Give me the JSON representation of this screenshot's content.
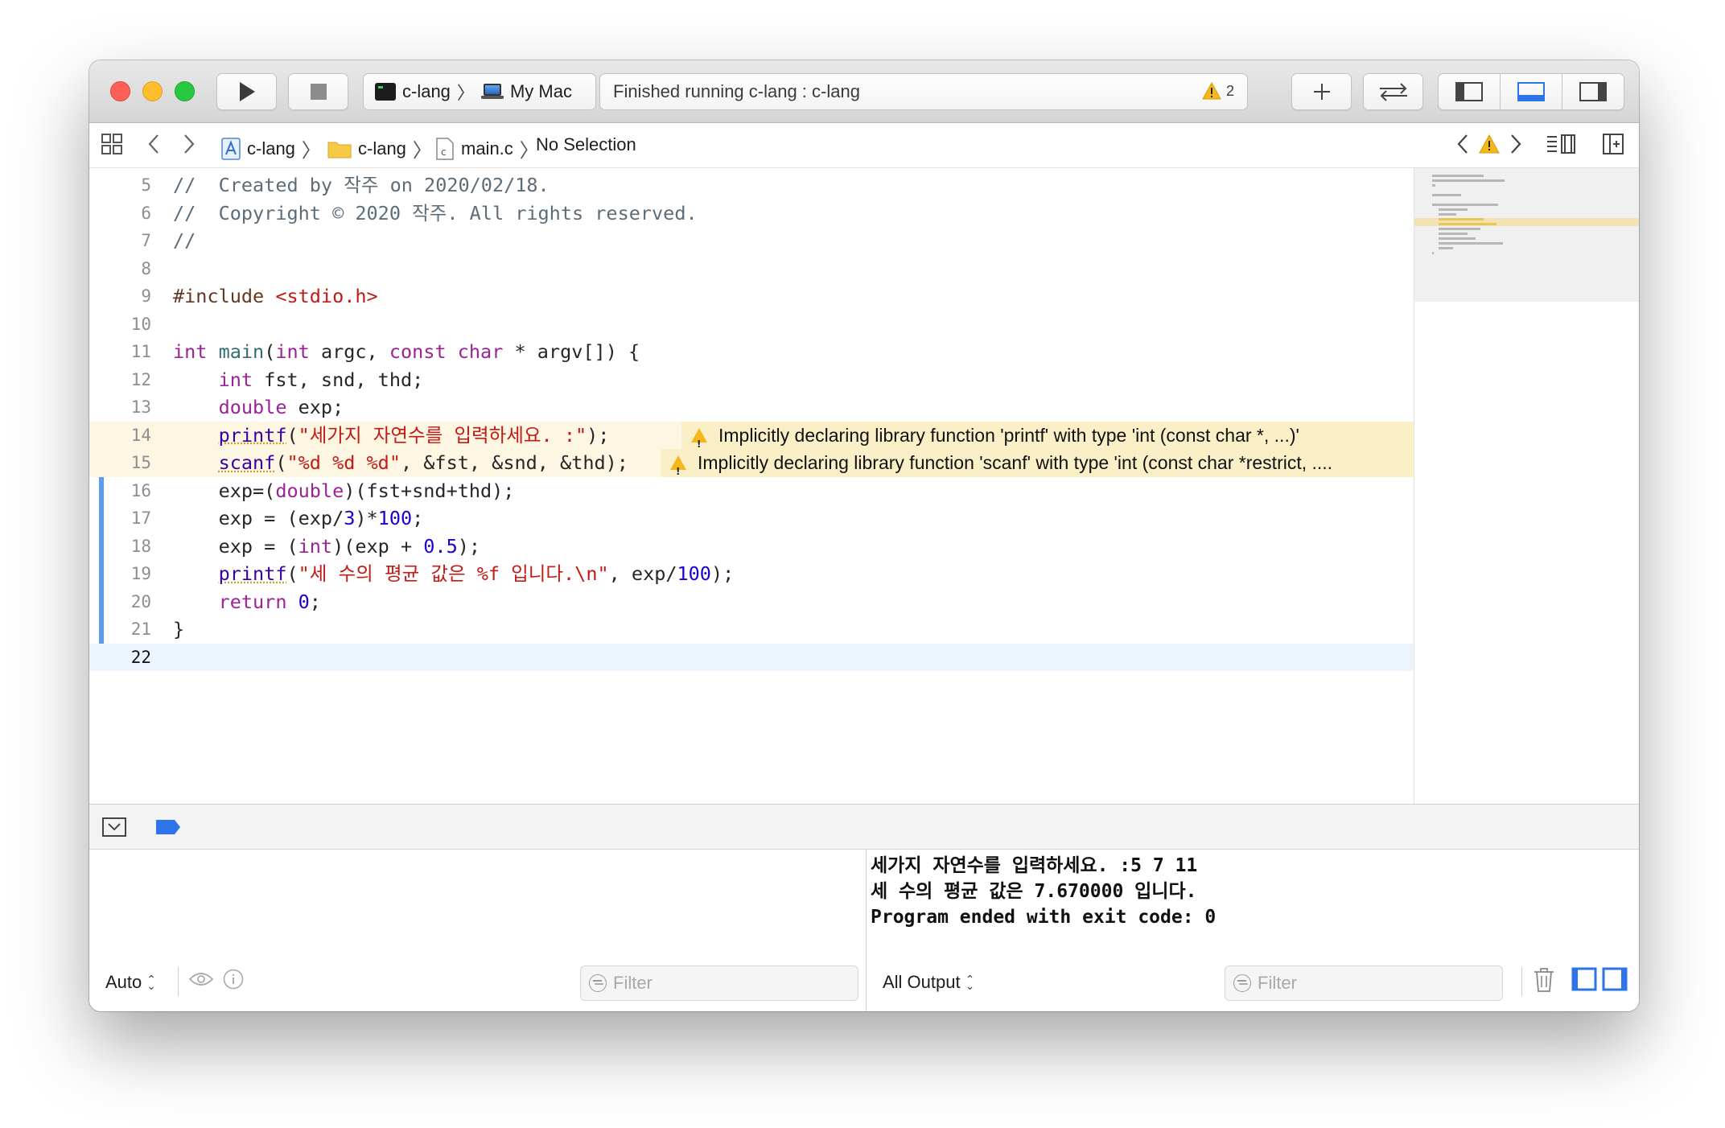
{
  "toolbar": {
    "scheme_target": "c-lang",
    "scheme_device": "My Mac",
    "activity_status": "Finished running c-lang : c-lang",
    "warning_count": "2"
  },
  "jumpbar": {
    "project": "c-lang",
    "group": "c-lang",
    "file": "main.c",
    "symbol": "No Selection"
  },
  "editor": {
    "lines": [
      {
        "num": "5",
        "text": "//  Created by 작주 on 2020/02/18."
      },
      {
        "num": "6",
        "text": "//  Copyright © 2020 작주. All rights reserved."
      },
      {
        "num": "7",
        "text": "//"
      },
      {
        "num": "8",
        "text": ""
      },
      {
        "num": "9",
        "text": "#include <stdio.h>"
      },
      {
        "num": "10",
        "text": ""
      },
      {
        "num": "11",
        "text": "int main(int argc, const char * argv[]) {"
      },
      {
        "num": "12",
        "text": "    int fst, snd, thd;"
      },
      {
        "num": "13",
        "text": "    double exp;"
      },
      {
        "num": "14",
        "text": "    printf(\"세가지 자연수를 입력하세요. :\");"
      },
      {
        "num": "15",
        "text": "    scanf(\"%d %d %d\", &fst, &snd, &thd);"
      },
      {
        "num": "16",
        "text": "    exp=(double)(fst+snd+thd);"
      },
      {
        "num": "17",
        "text": "    exp = (exp/3)*100;"
      },
      {
        "num": "18",
        "text": "    exp = (int)(exp + 0.5);"
      },
      {
        "num": "19",
        "text": "    printf(\"세 수의 평균 값은 %f 입니다.\\n\", exp/100);"
      },
      {
        "num": "20",
        "text": "    return 0;"
      },
      {
        "num": "21",
        "text": "}"
      },
      {
        "num": "22",
        "text": ""
      }
    ],
    "warnings": [
      "Implicitly declaring library function 'printf' with type 'int (const char *, ...)'",
      "Implicitly declaring library function 'scanf' with type 'int (const char *restrict, ...."
    ]
  },
  "debug": {
    "variables_scope": "Auto",
    "variables_filter_placeholder": "Filter",
    "console_scope": "All Output",
    "console_filter_placeholder": "Filter",
    "console_output": "세가지 자연수를 입력하세요. :5 7 11\n세 수의 평균 값은 7.670000 입니다.\nProgram ended with exit code: 0"
  },
  "colors": {
    "keyword": "#9b2393",
    "string": "#c41a16",
    "number": "#1c00cf",
    "comment": "#5d6c79",
    "warning_bg": "#fbefc7",
    "accent": "#2c74e8"
  }
}
